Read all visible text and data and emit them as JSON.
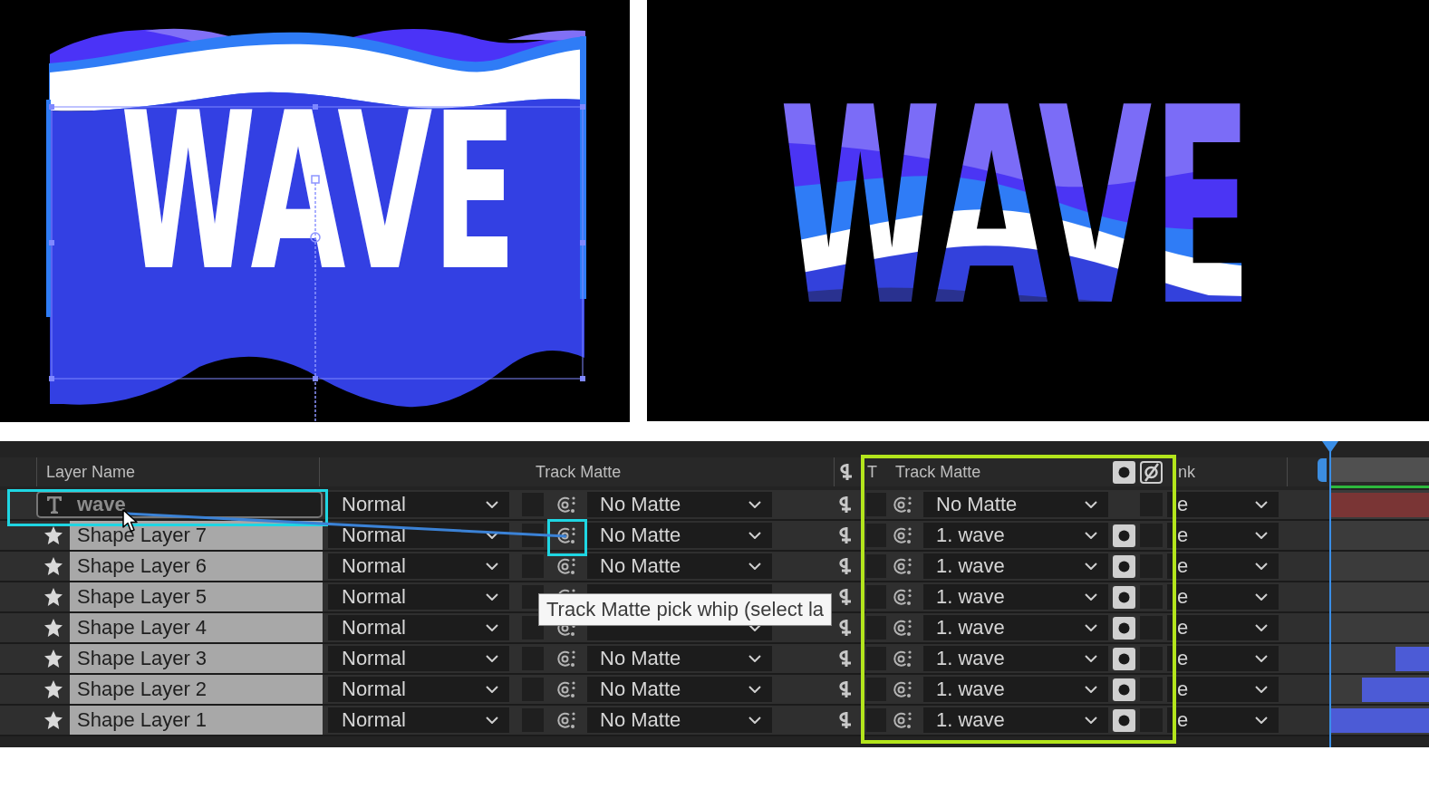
{
  "viewer": {
    "panels": [
      {
        "kind": "source",
        "text": "WAVE"
      },
      {
        "kind": "matte_result",
        "text": "WAVE"
      }
    ]
  },
  "timeline": {
    "header": {
      "layer_name": "Layer Name",
      "track_matte": "Track Matte",
      "preserve_column": "T",
      "new_track_matte": "Track Matte",
      "parent_partial": "nk"
    },
    "layers": [
      {
        "kind": "text",
        "name": "wave",
        "selected": false,
        "mode": "Normal",
        "matte": "No Matte",
        "new_matte": "No Matte",
        "alpha_matte": false,
        "parent": "e",
        "bar": {
          "level": 1,
          "color": "#7a3535"
        }
      },
      {
        "kind": "shape",
        "name": "Shape Layer 7",
        "selected": true,
        "mode": "Normal",
        "matte": "No Matte",
        "new_matte": "1. wave",
        "alpha_matte": true,
        "parent": "e"
      },
      {
        "kind": "shape",
        "name": "Shape Layer 6",
        "selected": true,
        "mode": "Normal",
        "matte": "No Matte",
        "new_matte": "1. wave",
        "alpha_matte": true,
        "parent": "e"
      },
      {
        "kind": "shape",
        "name": "Shape Layer 5",
        "selected": true,
        "mode": "Normal",
        "new_matte": "1. wave",
        "alpha_matte": true,
        "parent": "e"
      },
      {
        "kind": "shape",
        "name": "Shape Layer 4",
        "selected": true,
        "mode": "Normal",
        "new_matte": "1. wave",
        "alpha_matte": true,
        "parent": "e"
      },
      {
        "kind": "shape",
        "name": "Shape Layer 3",
        "selected": true,
        "mode": "Normal",
        "matte": "No Matte",
        "new_matte": "1. wave",
        "alpha_matte": true,
        "parent": "e",
        "bar": {
          "level": 0.34,
          "color": "#4c5bd6"
        }
      },
      {
        "kind": "shape",
        "name": "Shape Layer 2",
        "selected": true,
        "mode": "Normal",
        "matte": "No Matte",
        "new_matte": "1. wave",
        "alpha_matte": true,
        "parent": "e",
        "bar": {
          "level": 0.68,
          "color": "#4c5bd6"
        }
      },
      {
        "kind": "shape",
        "name": "Shape Layer 1",
        "selected": true,
        "mode": "Normal",
        "matte": "No Matte",
        "new_matte": "1. wave",
        "alpha_matte": true,
        "parent": "e",
        "bar": {
          "level": 1,
          "color": "#4c5bd6"
        }
      }
    ],
    "tooltip": "Track Matte pick whip (select la"
  }
}
